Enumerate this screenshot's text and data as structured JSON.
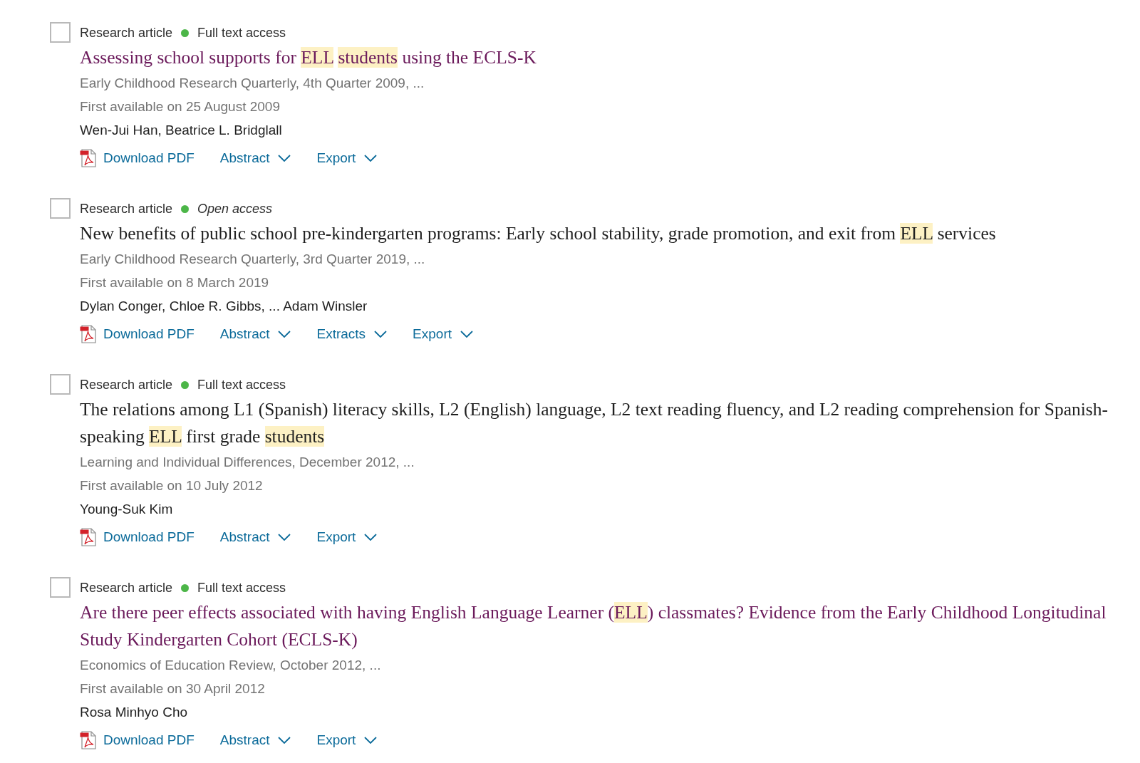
{
  "results": [
    {
      "checked": false,
      "type": "Research article",
      "access": {
        "kind": "full",
        "label": "Full text access"
      },
      "title": {
        "visited": true,
        "parts": [
          {
            "text": "Assessing school supports for ",
            "highlighted": false
          },
          {
            "text": "ELL ",
            "highlighted": true
          },
          {
            "text": "students",
            "highlighted": true
          },
          {
            "text": " using the ECLS-K",
            "highlighted": false
          }
        ]
      },
      "source": "Early Childhood Research Quarterly, 4th Quarter 2009, ...",
      "available": "First available on 25 August 2009",
      "authors": "Wen-Jui Han, Beatrice L. Bridglall",
      "actions": [
        {
          "kind": "pdf",
          "label": "Download PDF"
        },
        {
          "kind": "menu",
          "label": "Abstract"
        },
        {
          "kind": "menu",
          "label": "Export"
        }
      ]
    },
    {
      "checked": false,
      "type": "Research article",
      "access": {
        "kind": "open",
        "label": "Open access"
      },
      "title": {
        "visited": false,
        "parts": [
          {
            "text": "New benefits of public school pre-kindergarten programs: Early school stability, grade promotion, and exit from ",
            "highlighted": false
          },
          {
            "text": "ELL",
            "highlighted": true
          },
          {
            "text": " services",
            "highlighted": false
          }
        ]
      },
      "source": "Early Childhood Research Quarterly, 3rd Quarter 2019, ...",
      "available": "First available on 8 March 2019",
      "authors": "Dylan Conger, Chloe R. Gibbs, ... Adam Winsler",
      "actions": [
        {
          "kind": "pdf",
          "label": "Download PDF"
        },
        {
          "kind": "menu",
          "label": "Abstract"
        },
        {
          "kind": "menu",
          "label": "Extracts"
        },
        {
          "kind": "menu",
          "label": "Export"
        }
      ]
    },
    {
      "checked": false,
      "type": "Research article",
      "access": {
        "kind": "full",
        "label": "Full text access"
      },
      "title": {
        "visited": false,
        "parts": [
          {
            "text": "The relations among L1 (Spanish) literacy skills, L2 (English) language, L2 text reading fluency, and L2 reading comprehension for Spanish-speaking ",
            "highlighted": false
          },
          {
            "text": "ELL",
            "highlighted": true
          },
          {
            "text": " first grade ",
            "highlighted": false
          },
          {
            "text": "students",
            "highlighted": true
          }
        ]
      },
      "source": "Learning and Individual Differences, December 2012, ...",
      "available": "First available on 10 July 2012",
      "authors": "Young-Suk Kim",
      "actions": [
        {
          "kind": "pdf",
          "label": "Download PDF"
        },
        {
          "kind": "menu",
          "label": "Abstract"
        },
        {
          "kind": "menu",
          "label": "Export"
        }
      ]
    },
    {
      "checked": false,
      "type": "Research article",
      "access": {
        "kind": "full",
        "label": "Full text access"
      },
      "title": {
        "visited": true,
        "parts": [
          {
            "text": "Are there peer effects associated with having English Language Learner (",
            "highlighted": false
          },
          {
            "text": "ELL",
            "highlighted": true
          },
          {
            "text": ") classmates? Evidence from the Early Childhood Longitudinal Study Kindergarten Cohort (ECLS-K)",
            "highlighted": false
          }
        ]
      },
      "source": "Economics of Education Review, October 2012, ...",
      "available": "First available on 30 April 2012",
      "authors": "Rosa Minhyo Cho",
      "actions": [
        {
          "kind": "pdf",
          "label": "Download PDF"
        },
        {
          "kind": "menu",
          "label": "Abstract"
        },
        {
          "kind": "menu",
          "label": "Export"
        }
      ]
    }
  ]
}
